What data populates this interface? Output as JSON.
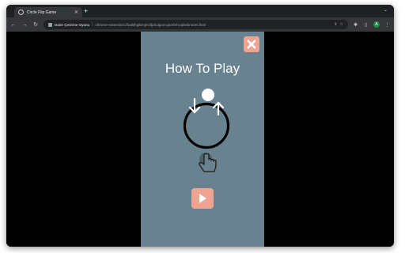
{
  "browser": {
    "tab": {
      "title": "Circle Flip Game",
      "favicon": "globe-icon"
    },
    "toolbar": {
      "extension_name": "Daire Çevirme Oyunu",
      "url": "chrome-extension://baiklhgibmjmcfjplcdgomcjamfehcajhebnotes.html"
    },
    "profile_initial": "A"
  },
  "game": {
    "title": "How To Play",
    "panel_color": "#688290",
    "accent_color": "#f0a391",
    "icons": {
      "close": "close-icon",
      "play": "play-icon",
      "hand": "hand-pointer-icon"
    }
  }
}
